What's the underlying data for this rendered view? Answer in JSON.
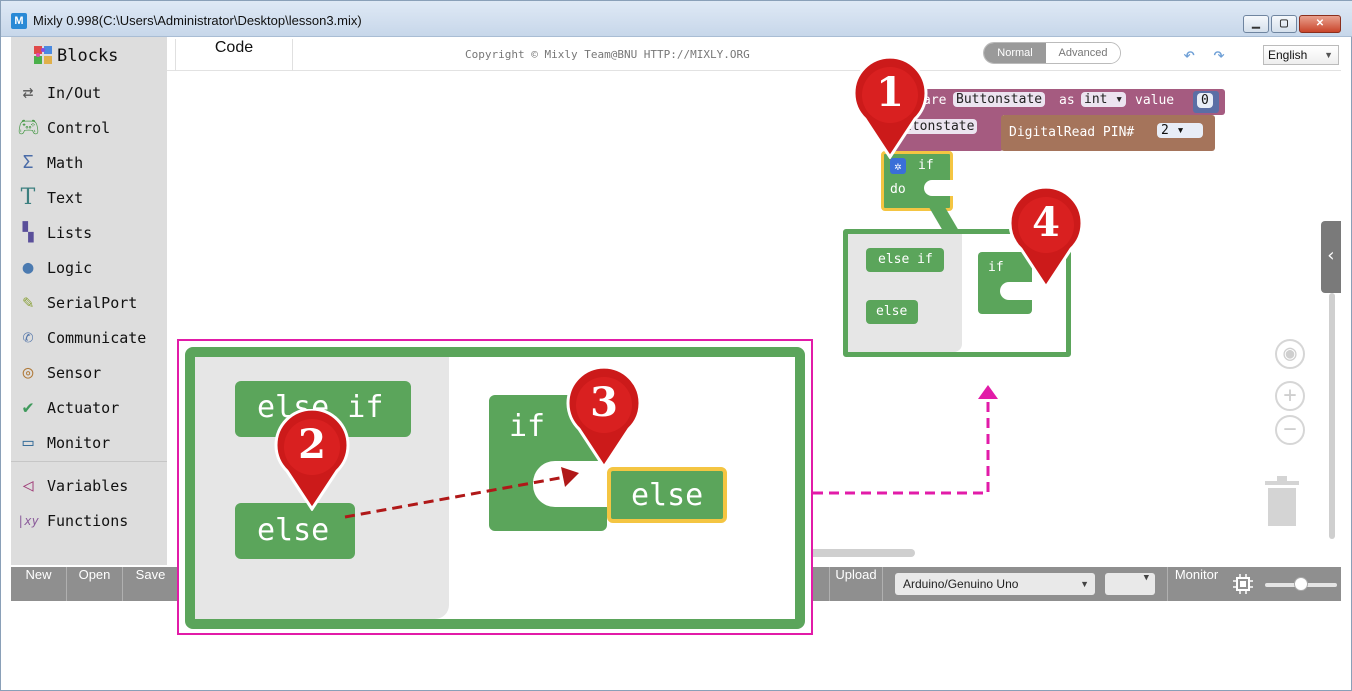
{
  "window": {
    "title": "Mixly 0.998(C:\\Users\\Administrator\\Desktop\\lesson3.mix)",
    "logo": "M",
    "buttons": [
      "minimize-icon",
      "maximize-icon",
      "close-icon"
    ]
  },
  "toolbox": {
    "header": "Blocks",
    "categories": [
      {
        "label": "In/Out",
        "icon": "arrows-icon",
        "color": "#6c6c6c"
      },
      {
        "label": "Control",
        "icon": "gamepad-icon",
        "color": "#4b9a4b"
      },
      {
        "label": "Math",
        "icon": "math-icon",
        "color": "#4a6ca8"
      },
      {
        "label": "Text",
        "icon": "text-icon",
        "color": "#3b7f7f"
      },
      {
        "label": "Lists",
        "icon": "lists-icon",
        "color": "#5a4f9a"
      },
      {
        "label": "Logic",
        "icon": "bulb-icon",
        "color": "#4b7ab0"
      },
      {
        "label": "SerialPort",
        "icon": "pen-icon",
        "color": "#8aa13a"
      },
      {
        "label": "Communicate",
        "icon": "chat-icon",
        "color": "#5577aa"
      },
      {
        "label": "Sensor",
        "icon": "sensor-icon",
        "color": "#b07a3a"
      },
      {
        "label": "Actuator",
        "icon": "actuator-icon",
        "color": "#3f9a5c"
      },
      {
        "label": "Monitor",
        "icon": "monitor-icon",
        "color": "#3a6f9a"
      },
      {
        "label": "Variables",
        "icon": "variables-icon",
        "color": "#a0407a"
      },
      {
        "label": "Functions",
        "icon": "functions-icon",
        "color": "#8a5a9a"
      }
    ]
  },
  "tabs": {
    "code": "Code",
    "copyright": "Copyright © Mixly Team@BNU HTTP://MIXLY.ORG",
    "mode_normal": "Normal",
    "mode_advanced": "Advanced",
    "language": "English"
  },
  "blocks": {
    "declare_prefix": "are",
    "declare_var": "Buttonstate",
    "declare_as": "as",
    "declare_type": "int",
    "declare_value_label": "value",
    "declare_value": "0",
    "assign_var": "ttonstate",
    "digitalread": "DigitalRead PIN#",
    "pin": "2",
    "if_label": "if",
    "do_label": "do"
  },
  "mutator": {
    "else_if": "else if",
    "else": "else",
    "if": "if"
  },
  "zoom": {
    "else_if": "else if",
    "else": "else",
    "if": "if",
    "else_dropped": "else"
  },
  "annotations": [
    "1",
    "2",
    "3",
    "4"
  ],
  "bottombar": {
    "new": "New",
    "open": "Open",
    "save": "Save",
    "upload": "Upload",
    "board": "Arduino/Genuino Uno",
    "port": "",
    "monitor": "Monitor"
  },
  "colors": {
    "block_green": "#5ba55b",
    "variable_purple": "#a55b80",
    "io_brown": "#a5745b",
    "highlight_yellow": "#f4c542",
    "callout_magenta": "#e21ba8",
    "marker_red": "#cc1a1a"
  }
}
